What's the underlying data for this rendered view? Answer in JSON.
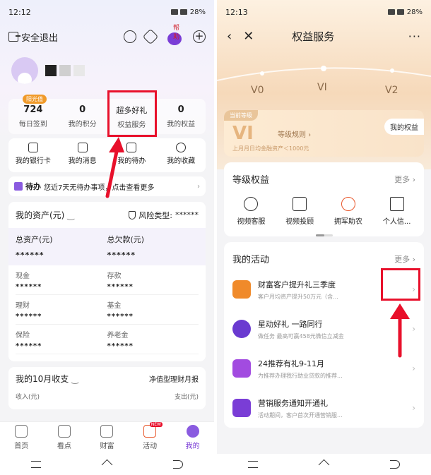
{
  "left": {
    "status": {
      "time": "12:12",
      "battery": "28%"
    },
    "topbar": {
      "logout": "安全退出",
      "mascot_tag": "帮助"
    },
    "stats": [
      {
        "value": "724",
        "label": "每日签到",
        "badge": "阳光值"
      },
      {
        "value": "0",
        "label": "我的积分"
      },
      {
        "value": "超多好礼",
        "label": "权益服务"
      },
      {
        "value": "0",
        "label": "我的权益"
      }
    ],
    "quick": [
      "我的银行卡",
      "我的消息",
      "我的待办",
      "我的收藏"
    ],
    "todo": {
      "title": "待办",
      "text": "您近7天无待办事项，点击查看更多"
    },
    "assets": {
      "title": "我的资产(元)",
      "risk_label": "风险类型:",
      "risk_value": "******",
      "total_assets_label": "总资产(元)",
      "total_assets_value": "******",
      "total_debt_label": "总欠款(元)",
      "total_debt_value": "******",
      "cells": [
        {
          "label": "现金",
          "value": "******"
        },
        {
          "label": "存款",
          "value": "******"
        },
        {
          "label": "理财",
          "value": "******"
        },
        {
          "label": "基金",
          "value": "******"
        },
        {
          "label": "保险",
          "value": "******"
        },
        {
          "label": "养老金",
          "value": "******"
        }
      ]
    },
    "income": {
      "title": "我的10月收支",
      "report": "净值型理财月报",
      "in_label": "收入(元)",
      "out_label": "支出(元)"
    },
    "tabs": [
      "首页",
      "看点",
      "财富",
      "活动",
      "我的"
    ],
    "tab_new": "NEW"
  },
  "right": {
    "status": {
      "time": "12:13",
      "battery": "28%"
    },
    "title": "权益服务",
    "levels": [
      "V0",
      "VI",
      "V2"
    ],
    "current": {
      "tag": "当前等级",
      "level": "VI",
      "rule": "等级规则 ›",
      "desc": "上月月日均金融资产＜1000元",
      "my_rights": "我的权益"
    },
    "rights": {
      "title": "等级权益",
      "more": "更多 ›",
      "items": [
        "视频客服",
        "视频投顾",
        "拥军助农",
        "个人信..."
      ]
    },
    "activities": {
      "title": "我的活动",
      "more": "更多 ›",
      "items": [
        {
          "title": "财富客户提升礼三季度",
          "sub": "客户月均资产提升50万元（含...",
          "color": "#f08a2a"
        },
        {
          "title": "星动好礼 一路同行",
          "sub": "做任务 最高可赢458元微信立减金",
          "color": "#6a3ad0"
        },
        {
          "title": "24推荐有礼9-11月",
          "sub": "为推荐办理我行助业贷款的推荐...",
          "color": "#a24be0"
        },
        {
          "title": "营销服务通知开通礼",
          "sub": "活动期间，客户首次开通营销服...",
          "color": "#7a3dd6"
        }
      ]
    }
  }
}
